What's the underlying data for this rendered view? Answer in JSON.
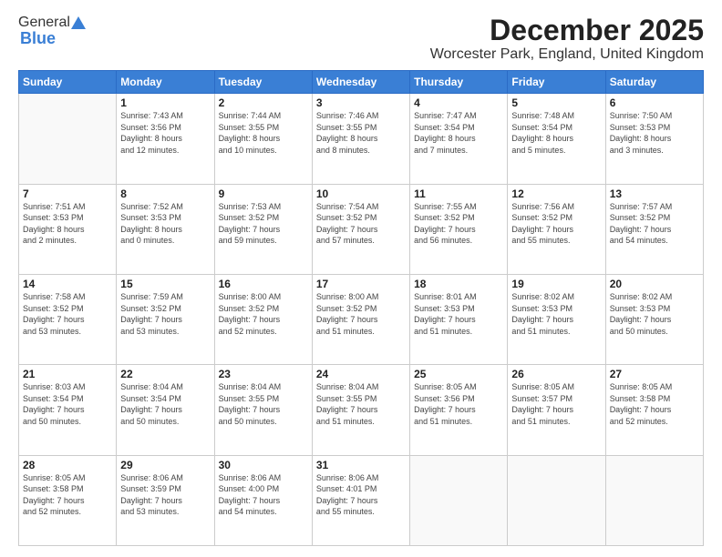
{
  "header": {
    "logo_general": "General",
    "logo_blue": "Blue",
    "month_title": "December 2025",
    "location": "Worcester Park, England, United Kingdom"
  },
  "weekdays": [
    "Sunday",
    "Monday",
    "Tuesday",
    "Wednesday",
    "Thursday",
    "Friday",
    "Saturday"
  ],
  "weeks": [
    [
      {
        "day": "",
        "info": ""
      },
      {
        "day": "1",
        "info": "Sunrise: 7:43 AM\nSunset: 3:56 PM\nDaylight: 8 hours\nand 12 minutes."
      },
      {
        "day": "2",
        "info": "Sunrise: 7:44 AM\nSunset: 3:55 PM\nDaylight: 8 hours\nand 10 minutes."
      },
      {
        "day": "3",
        "info": "Sunrise: 7:46 AM\nSunset: 3:55 PM\nDaylight: 8 hours\nand 8 minutes."
      },
      {
        "day": "4",
        "info": "Sunrise: 7:47 AM\nSunset: 3:54 PM\nDaylight: 8 hours\nand 7 minutes."
      },
      {
        "day": "5",
        "info": "Sunrise: 7:48 AM\nSunset: 3:54 PM\nDaylight: 8 hours\nand 5 minutes."
      },
      {
        "day": "6",
        "info": "Sunrise: 7:50 AM\nSunset: 3:53 PM\nDaylight: 8 hours\nand 3 minutes."
      }
    ],
    [
      {
        "day": "7",
        "info": "Sunrise: 7:51 AM\nSunset: 3:53 PM\nDaylight: 8 hours\nand 2 minutes."
      },
      {
        "day": "8",
        "info": "Sunrise: 7:52 AM\nSunset: 3:53 PM\nDaylight: 8 hours\nand 0 minutes."
      },
      {
        "day": "9",
        "info": "Sunrise: 7:53 AM\nSunset: 3:52 PM\nDaylight: 7 hours\nand 59 minutes."
      },
      {
        "day": "10",
        "info": "Sunrise: 7:54 AM\nSunset: 3:52 PM\nDaylight: 7 hours\nand 57 minutes."
      },
      {
        "day": "11",
        "info": "Sunrise: 7:55 AM\nSunset: 3:52 PM\nDaylight: 7 hours\nand 56 minutes."
      },
      {
        "day": "12",
        "info": "Sunrise: 7:56 AM\nSunset: 3:52 PM\nDaylight: 7 hours\nand 55 minutes."
      },
      {
        "day": "13",
        "info": "Sunrise: 7:57 AM\nSunset: 3:52 PM\nDaylight: 7 hours\nand 54 minutes."
      }
    ],
    [
      {
        "day": "14",
        "info": "Sunrise: 7:58 AM\nSunset: 3:52 PM\nDaylight: 7 hours\nand 53 minutes."
      },
      {
        "day": "15",
        "info": "Sunrise: 7:59 AM\nSunset: 3:52 PM\nDaylight: 7 hours\nand 53 minutes."
      },
      {
        "day": "16",
        "info": "Sunrise: 8:00 AM\nSunset: 3:52 PM\nDaylight: 7 hours\nand 52 minutes."
      },
      {
        "day": "17",
        "info": "Sunrise: 8:00 AM\nSunset: 3:52 PM\nDaylight: 7 hours\nand 51 minutes."
      },
      {
        "day": "18",
        "info": "Sunrise: 8:01 AM\nSunset: 3:53 PM\nDaylight: 7 hours\nand 51 minutes."
      },
      {
        "day": "19",
        "info": "Sunrise: 8:02 AM\nSunset: 3:53 PM\nDaylight: 7 hours\nand 51 minutes."
      },
      {
        "day": "20",
        "info": "Sunrise: 8:02 AM\nSunset: 3:53 PM\nDaylight: 7 hours\nand 50 minutes."
      }
    ],
    [
      {
        "day": "21",
        "info": "Sunrise: 8:03 AM\nSunset: 3:54 PM\nDaylight: 7 hours\nand 50 minutes."
      },
      {
        "day": "22",
        "info": "Sunrise: 8:04 AM\nSunset: 3:54 PM\nDaylight: 7 hours\nand 50 minutes."
      },
      {
        "day": "23",
        "info": "Sunrise: 8:04 AM\nSunset: 3:55 PM\nDaylight: 7 hours\nand 50 minutes."
      },
      {
        "day": "24",
        "info": "Sunrise: 8:04 AM\nSunset: 3:55 PM\nDaylight: 7 hours\nand 51 minutes."
      },
      {
        "day": "25",
        "info": "Sunrise: 8:05 AM\nSunset: 3:56 PM\nDaylight: 7 hours\nand 51 minutes."
      },
      {
        "day": "26",
        "info": "Sunrise: 8:05 AM\nSunset: 3:57 PM\nDaylight: 7 hours\nand 51 minutes."
      },
      {
        "day": "27",
        "info": "Sunrise: 8:05 AM\nSunset: 3:58 PM\nDaylight: 7 hours\nand 52 minutes."
      }
    ],
    [
      {
        "day": "28",
        "info": "Sunrise: 8:05 AM\nSunset: 3:58 PM\nDaylight: 7 hours\nand 52 minutes."
      },
      {
        "day": "29",
        "info": "Sunrise: 8:06 AM\nSunset: 3:59 PM\nDaylight: 7 hours\nand 53 minutes."
      },
      {
        "day": "30",
        "info": "Sunrise: 8:06 AM\nSunset: 4:00 PM\nDaylight: 7 hours\nand 54 minutes."
      },
      {
        "day": "31",
        "info": "Sunrise: 8:06 AM\nSunset: 4:01 PM\nDaylight: 7 hours\nand 55 minutes."
      },
      {
        "day": "",
        "info": ""
      },
      {
        "day": "",
        "info": ""
      },
      {
        "day": "",
        "info": ""
      }
    ]
  ]
}
